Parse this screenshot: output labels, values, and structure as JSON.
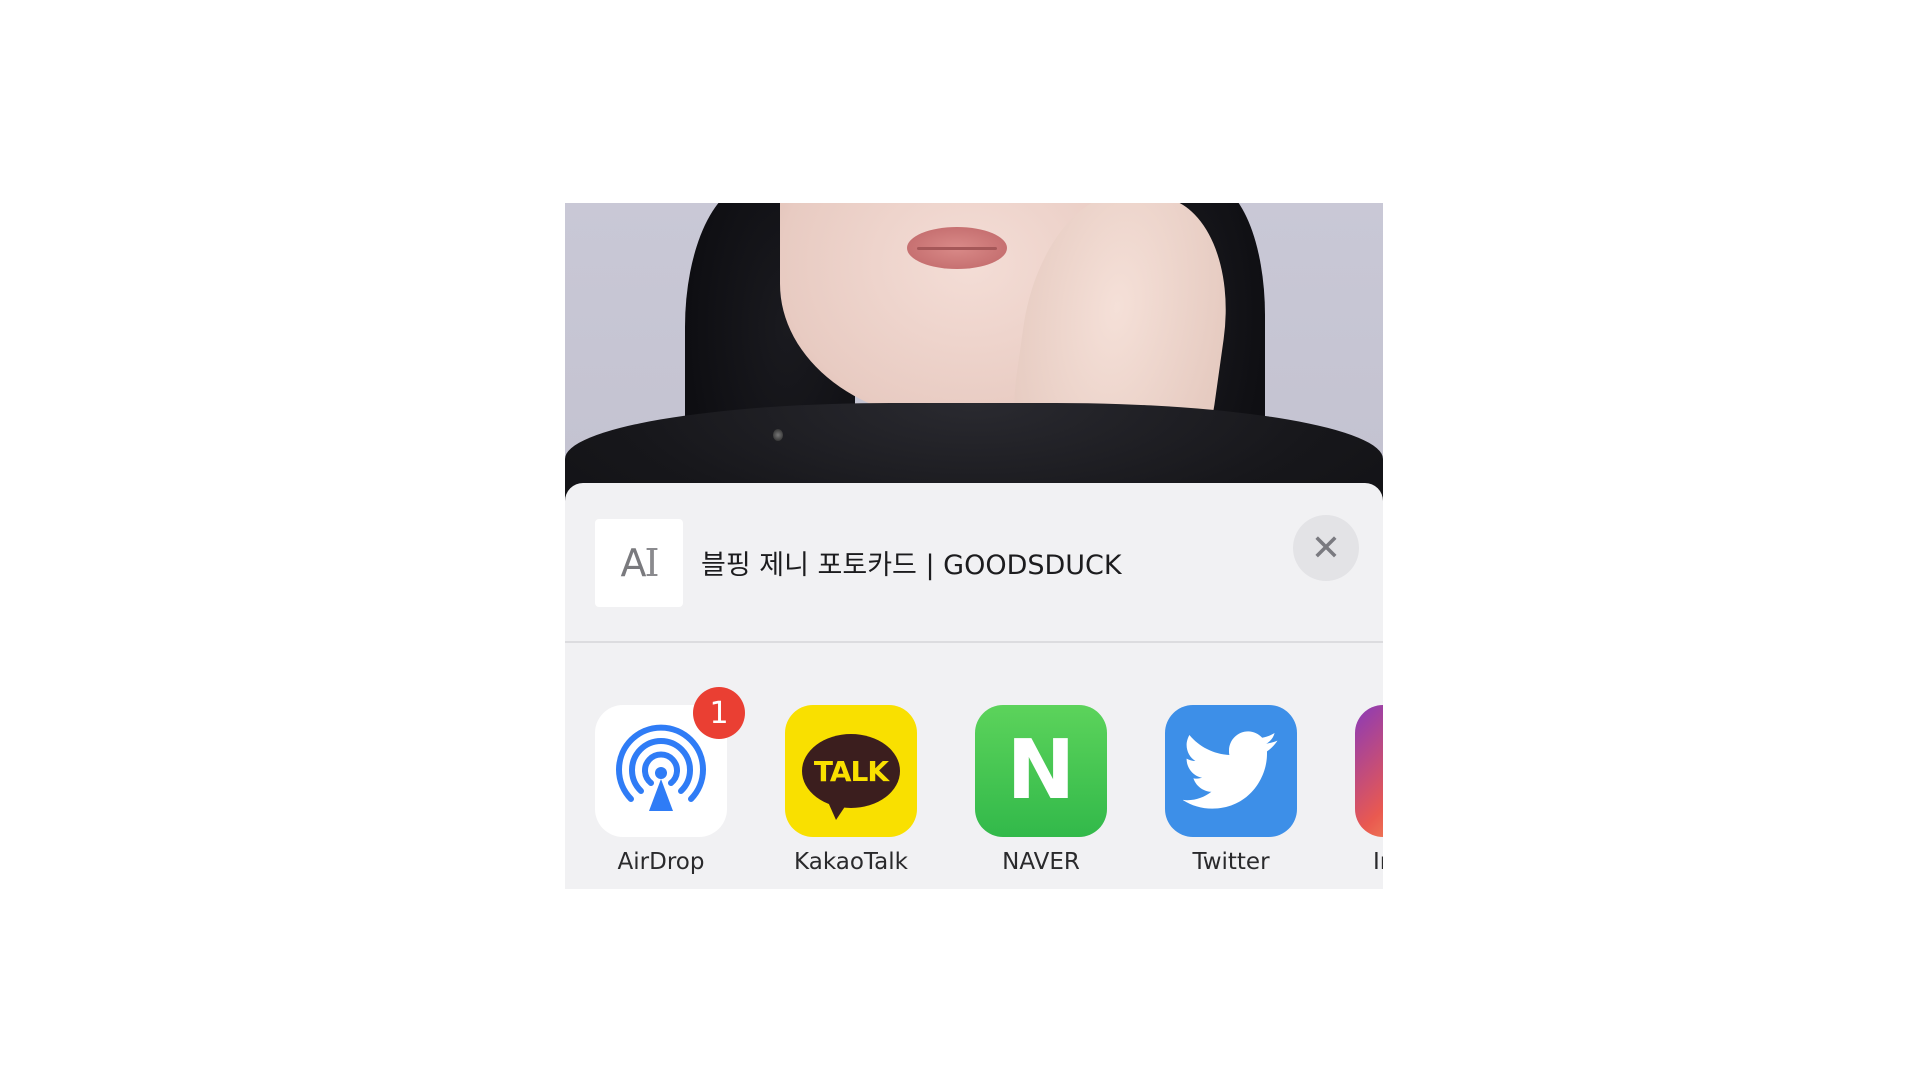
{
  "share_sheet": {
    "title": "블핑 제니 포토카드 | GOODSDUCK",
    "thumbnail": {
      "letter": "A",
      "cursor": "I",
      "icon": "text-document-icon"
    },
    "close_icon": "close-icon",
    "close_glyph": "✕"
  },
  "apps": [
    {
      "id": "airdrop",
      "label": "AirDrop",
      "icon": "airdrop-icon",
      "badge": "1"
    },
    {
      "id": "kakaotalk",
      "label": "KakaoTalk",
      "icon": "kakaotalk-icon",
      "glyph": "TALK"
    },
    {
      "id": "naver",
      "label": "NAVER",
      "icon": "naver-icon",
      "glyph": "N"
    },
    {
      "id": "twitter",
      "label": "Twitter",
      "icon": "twitter-bird-icon"
    },
    {
      "id": "instagram",
      "label": "In",
      "icon": "instagram-icon"
    }
  ],
  "colors": {
    "airdrop_blue": "#2f7cf6",
    "badge_red": "#ea3f33",
    "kakao_yellow": "#f9e000",
    "naver_green": "#3dc24e",
    "twitter_blue": "#3d8fe8"
  }
}
